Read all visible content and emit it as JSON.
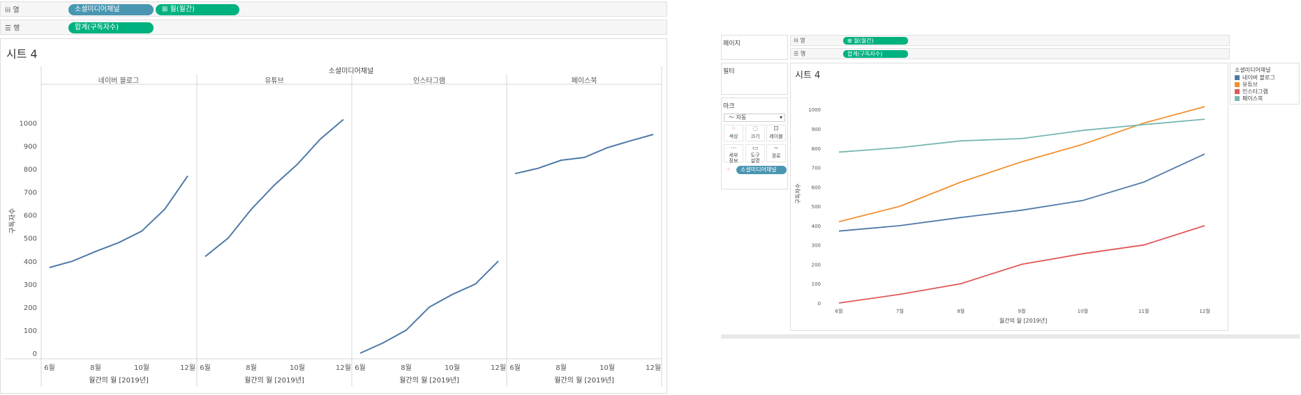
{
  "left": {
    "columns_shelf": {
      "icon": "iii",
      "label": "열",
      "pills": [
        "소셜미디어채널",
        "⊞ 월(월간)"
      ]
    },
    "rows_shelf": {
      "icon": "☰",
      "label": "행",
      "pills": [
        "합계(구독자수)"
      ]
    },
    "sheet_title": "시트 4",
    "header_title": "소셜미디어채널",
    "ylabel": "구독자수",
    "xlabel": "월간의 월 [2019년]"
  },
  "right": {
    "pages_label": "페이지",
    "filters_label": "필터",
    "marks_label": "마크",
    "marks_type": "〜 자동",
    "mark_buttons": [
      {
        "icon": "⁘",
        "label": "색상"
      },
      {
        "icon": "◌",
        "label": "크기"
      },
      {
        "icon": "⊡",
        "label": "레이블"
      },
      {
        "icon": "⋯",
        "label": "세부\n정보"
      },
      {
        "icon": "▭",
        "label": "도구\n설명"
      },
      {
        "icon": "∼",
        "label": "경로"
      }
    ],
    "color_pill": "소셜미디어채널",
    "columns_shelf": {
      "icon": "iii",
      "label": "열",
      "pills": [
        "⊞ 월(월간)"
      ]
    },
    "rows_shelf": {
      "icon": "☰",
      "label": "행",
      "pills": [
        "합계(구독자수)"
      ]
    },
    "sheet_title": "시트 4",
    "legend_title": "소셜미디어채널",
    "ylabel": "구독자수",
    "xlabel": "월간의 월 [2019년]"
  },
  "chart_data": [
    {
      "type": "line",
      "layout": "small-multiples",
      "facet_title": "소셜미디어채널",
      "xlabel": "월간의 월 [2019년]",
      "ylabel": "구독자수",
      "x": [
        "6월",
        "7월",
        "8월",
        "9월",
        "10월",
        "11월",
        "12월"
      ],
      "x_tick_labels": [
        "6월",
        "8월",
        "10월",
        "12월"
      ],
      "y_ticks": [
        0,
        100,
        200,
        300,
        400,
        500,
        600,
        700,
        800,
        900,
        1000
      ],
      "ylim": [
        0,
        1080
      ],
      "grid": false,
      "series": [
        {
          "name": "네이버 블로그",
          "values": [
            372,
            400,
            442,
            480,
            530,
            625,
            770
          ],
          "color": "#4e79a7"
        },
        {
          "name": "유튜브",
          "values": [
            420,
            500,
            625,
            730,
            820,
            930,
            1015
          ],
          "color": "#4e79a7"
        },
        {
          "name": "인스타그램",
          "values": [
            0,
            45,
            100,
            200,
            255,
            300,
            400
          ],
          "color": "#4e79a7"
        },
        {
          "name": "페이스북",
          "values": [
            780,
            803,
            838,
            850,
            892,
            922,
            950
          ],
          "color": "#4e79a7"
        }
      ]
    },
    {
      "type": "line",
      "layout": "combined",
      "xlabel": "월간의 월 [2019년]",
      "ylabel": "구독자수",
      "x": [
        "6월",
        "7월",
        "8월",
        "9월",
        "10월",
        "11월",
        "12월"
      ],
      "y_ticks": [
        0,
        100,
        200,
        300,
        400,
        500,
        600,
        700,
        800,
        900,
        1000
      ],
      "ylim": [
        0,
        1080
      ],
      "grid": false,
      "legend": "right",
      "series": [
        {
          "name": "네이버 블로그",
          "values": [
            372,
            400,
            442,
            480,
            530,
            625,
            770
          ],
          "color": "#4e79a7"
        },
        {
          "name": "유튜브",
          "values": [
            420,
            500,
            625,
            730,
            820,
            930,
            1015
          ],
          "color": "#f28e2b"
        },
        {
          "name": "인스타그램",
          "values": [
            0,
            45,
            100,
            200,
            255,
            300,
            400
          ],
          "color": "#e15759"
        },
        {
          "name": "페이스북",
          "values": [
            780,
            803,
            838,
            850,
            892,
            922,
            950
          ],
          "color": "#76b7b2"
        }
      ]
    }
  ]
}
